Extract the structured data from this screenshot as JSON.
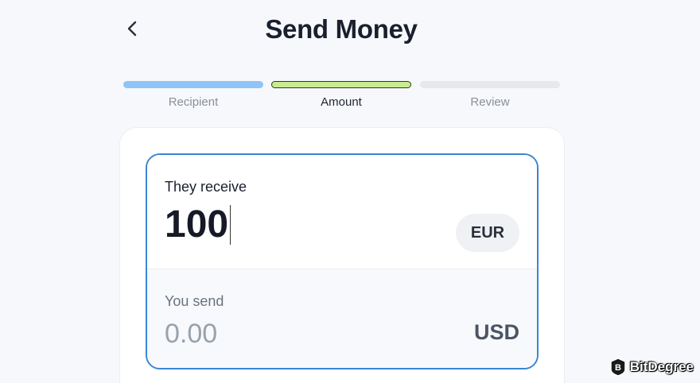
{
  "header": {
    "title": "Send Money",
    "back_icon": "chevron-left-icon"
  },
  "steps": [
    {
      "label": "Recipient",
      "state": "done",
      "color": "#8fc4f7"
    },
    {
      "label": "Amount",
      "state": "active",
      "color": "#c8ec8f"
    },
    {
      "label": "Review",
      "state": "pending",
      "color": "#e6e8ec"
    }
  ],
  "receive": {
    "label": "They receive",
    "value": "100",
    "currency": "EUR"
  },
  "send": {
    "label": "You send",
    "placeholder": "0.00",
    "currency": "USD"
  },
  "colors": {
    "accent_border": "#3a86d4",
    "background": "#f6f8fb"
  },
  "watermark": {
    "text": "BitDegree"
  }
}
